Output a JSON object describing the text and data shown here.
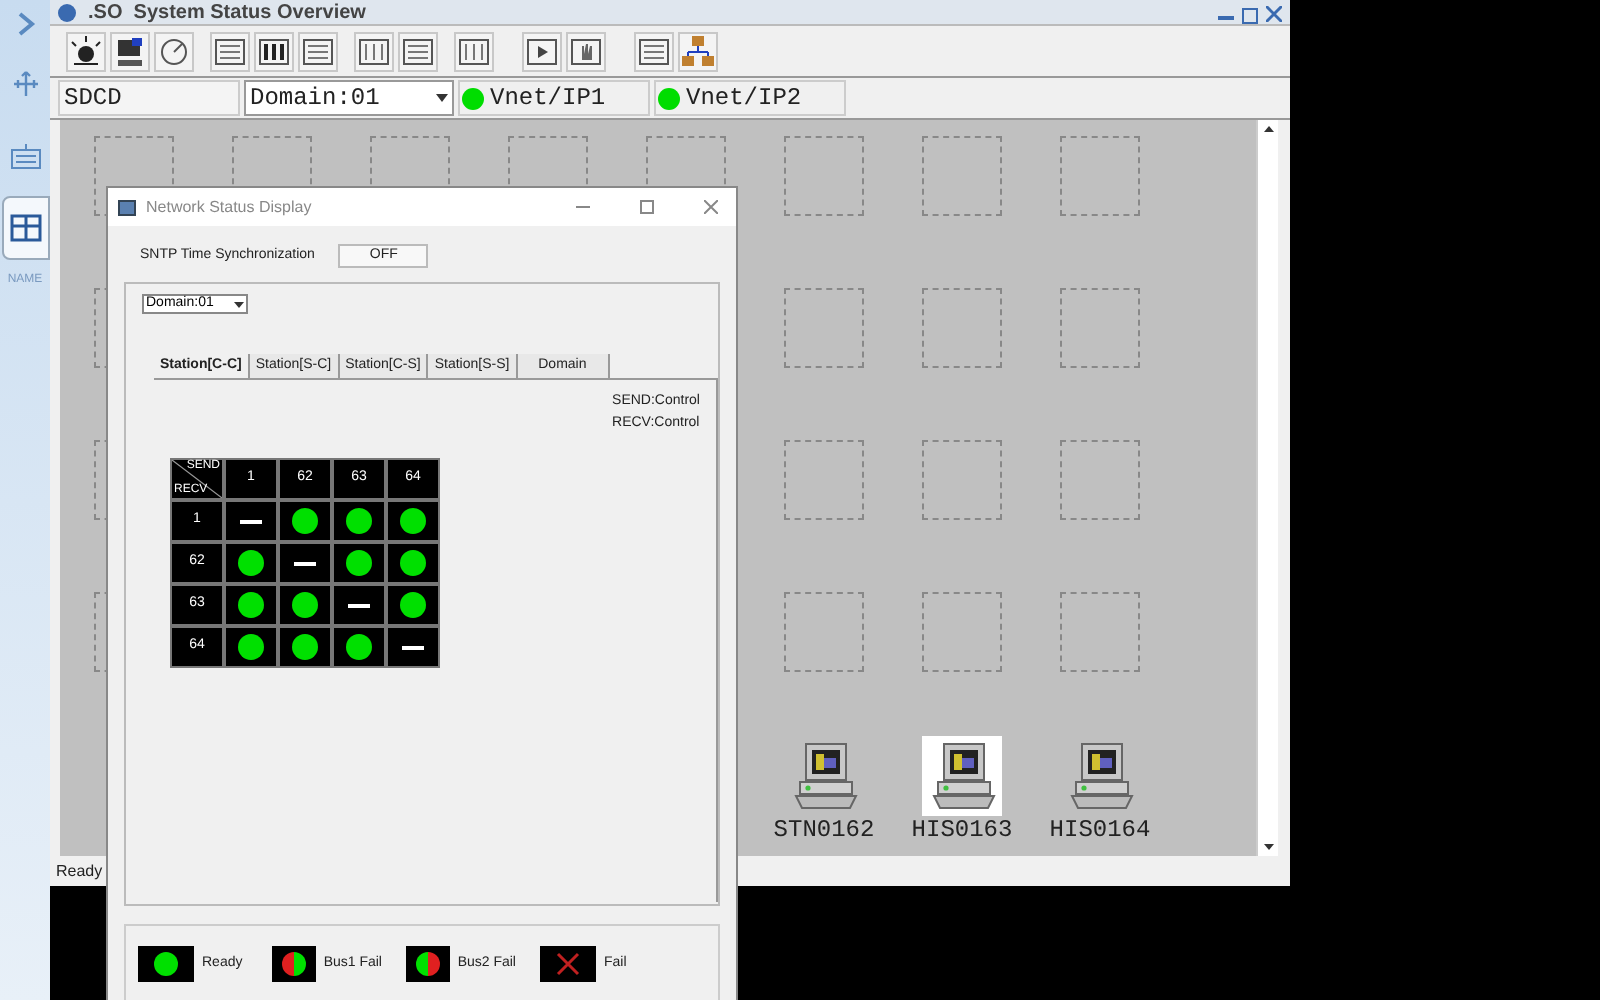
{
  "sidebar": {
    "items": [
      {
        "selected": false
      },
      {
        "selected": false
      },
      {
        "selected": false
      },
      {
        "selected": true
      }
    ],
    "caption": "NAME"
  },
  "window": {
    "title": ".SO  System Status Overview"
  },
  "status_row": {
    "system": "SDCD",
    "domain": "Domain:01",
    "buses": [
      {
        "label": "Vnet/IP1",
        "color": "#00dd00"
      },
      {
        "label": "Vnet/IP2",
        "color": "#00dd00"
      }
    ]
  },
  "stations": [
    {
      "name": "STN0162",
      "selected": false
    },
    {
      "name": "HIS0163",
      "selected": true
    },
    {
      "name": "HIS0164",
      "selected": false
    }
  ],
  "status_bar": "Ready",
  "dialog": {
    "title": "Network Status Display",
    "sntp_label": "SNTP Time Synchronization",
    "sntp_value": "OFF",
    "domain": "Domain:01",
    "tabs": [
      {
        "label": "Station[C-C]",
        "selected": true
      },
      {
        "label": "Station[S-C]",
        "selected": false
      },
      {
        "label": "Station[C-S]",
        "selected": false
      },
      {
        "label": "Station[S-S]",
        "selected": false
      },
      {
        "label": "Domain",
        "selected": false
      }
    ],
    "send_note": "SEND:Control",
    "recv_note": "RECV:Control",
    "matrix": {
      "send": "SEND",
      "recv": "RECV",
      "columns": [
        "1",
        "62",
        "63",
        "64"
      ],
      "rows": [
        {
          "label": "1",
          "cells": [
            {
              "kind": "self"
            },
            {
              "kind": "ready"
            },
            {
              "kind": "ready"
            },
            {
              "kind": "ready"
            }
          ]
        },
        {
          "label": "62",
          "cells": [
            {
              "kind": "ready"
            },
            {
              "kind": "self"
            },
            {
              "kind": "ready"
            },
            {
              "kind": "ready"
            }
          ]
        },
        {
          "label": "63",
          "cells": [
            {
              "kind": "ready"
            },
            {
              "kind": "ready"
            },
            {
              "kind": "self"
            },
            {
              "kind": "ready"
            }
          ]
        },
        {
          "label": "64",
          "cells": [
            {
              "kind": "ready"
            },
            {
              "kind": "ready"
            },
            {
              "kind": "ready"
            },
            {
              "kind": "self"
            }
          ]
        }
      ]
    },
    "legend": [
      {
        "kind": "ready",
        "label": "Ready"
      },
      {
        "kind": "bus1_fail",
        "label": "Bus1 Fail"
      },
      {
        "kind": "bus2_fail",
        "label": "Bus2 Fail"
      },
      {
        "kind": "fail",
        "label": "Fail"
      }
    ]
  }
}
